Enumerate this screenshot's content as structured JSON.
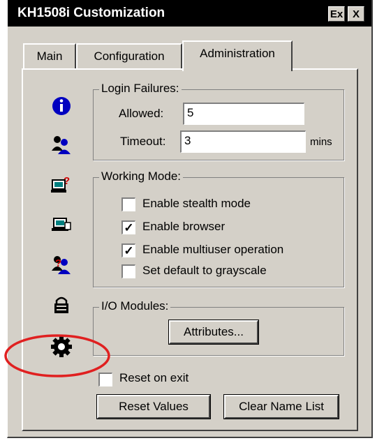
{
  "window": {
    "title": "KH1508i Customization",
    "title_buttons": [
      "Ex",
      "X"
    ]
  },
  "tabs": [
    {
      "label": "Main",
      "active": false
    },
    {
      "label": "Configuration",
      "active": false
    },
    {
      "label": "Administration",
      "active": true
    }
  ],
  "sidebar_icons": [
    "info-icon",
    "users-icon",
    "network-alert-icon",
    "network-icon",
    "user-alert-icon",
    "lock-icon",
    "gear-icon"
  ],
  "login_failures": {
    "title": "Login Failures:",
    "allowed_label": "Allowed:",
    "allowed_value": "5",
    "timeout_label": "Timeout:",
    "timeout_value": "3",
    "timeout_unit": "mins"
  },
  "working_mode": {
    "title": "Working Mode:",
    "options": [
      {
        "label": "Enable stealth mode",
        "checked": false
      },
      {
        "label": "Enable browser",
        "checked": true
      },
      {
        "label": "Enable multiuser operation",
        "checked": true
      },
      {
        "label": "Set default to grayscale",
        "checked": false
      }
    ]
  },
  "io_modules": {
    "title": "I/O Modules:",
    "attributes_button": "Attributes..."
  },
  "reset_on_exit": {
    "label": "Reset on exit",
    "checked": false
  },
  "buttons": {
    "reset_values": "Reset Values",
    "clear_name_list": "Clear Name List"
  },
  "colors": {
    "highlight_ellipse": "#e02020",
    "face": "#d4d0c8",
    "icon_blue": "#0000c0",
    "icon_red": "#d00000"
  }
}
